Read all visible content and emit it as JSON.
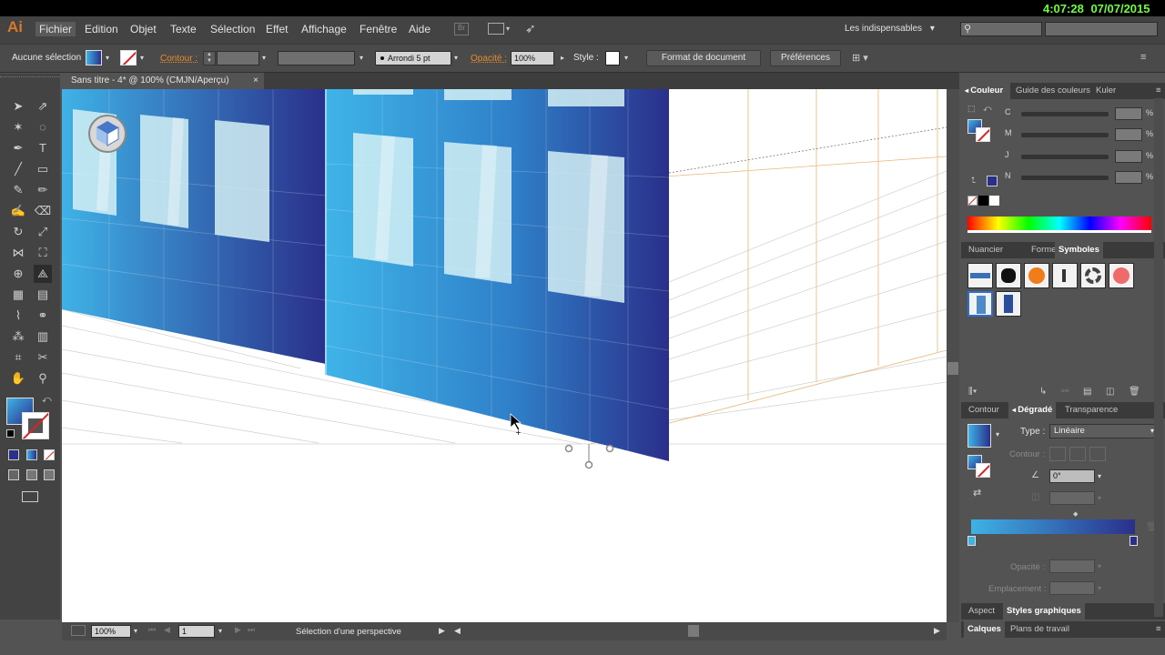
{
  "app": {
    "logo": "Ai",
    "workspace": "Les indispensables",
    "clock": "4:07:28",
    "date": "07/07/2015"
  },
  "menu": [
    "Fichier",
    "Edition",
    "Objet",
    "Texte",
    "Sélection",
    "Effet",
    "Affichage",
    "Fenêtre",
    "Aide"
  ],
  "control": {
    "selection": "Aucune sélection",
    "contour_label": "Contour :",
    "stroke_profile": "Arrondi 5 pt",
    "opacity_label": "Opacité :",
    "opacity_value": "100%",
    "style_label": "Style :",
    "doc_format_btn": "Format de document",
    "prefs_btn": "Préférences"
  },
  "document": {
    "tab_title": "Sans titre - 4* @ 100% (CMJN/Aperçu)",
    "close": "×"
  },
  "status": {
    "zoom": "100%",
    "page": "1",
    "message": "Sélection d'une perspective"
  },
  "panels": {
    "color_tabs": [
      "Couleur",
      "Guide des couleurs",
      "Kuler"
    ],
    "cmyk": [
      "C",
      "M",
      "J",
      "N"
    ],
    "percent": "%",
    "library_tabs": [
      "Nuancier",
      "Formes",
      "Symboles"
    ],
    "gradient_tabs": [
      "Contour",
      "Dégradé",
      "Transparence"
    ],
    "type_label": "Type :",
    "type_value": "Linéaire",
    "contour_label": "Contour :",
    "angle_value": "0°",
    "opacity_label": "Opacité :",
    "location_label": "Emplacement :",
    "style_tabs": [
      "Aspect",
      "Styles graphiques"
    ],
    "layer_tabs": [
      "Calques",
      "Plans de travail"
    ]
  },
  "colors": {
    "gradient_start": "#3fb2e6",
    "gradient_end": "#2a2f8a",
    "accent_orange": "#e88b2b",
    "clock_green": "#6dff3b"
  }
}
